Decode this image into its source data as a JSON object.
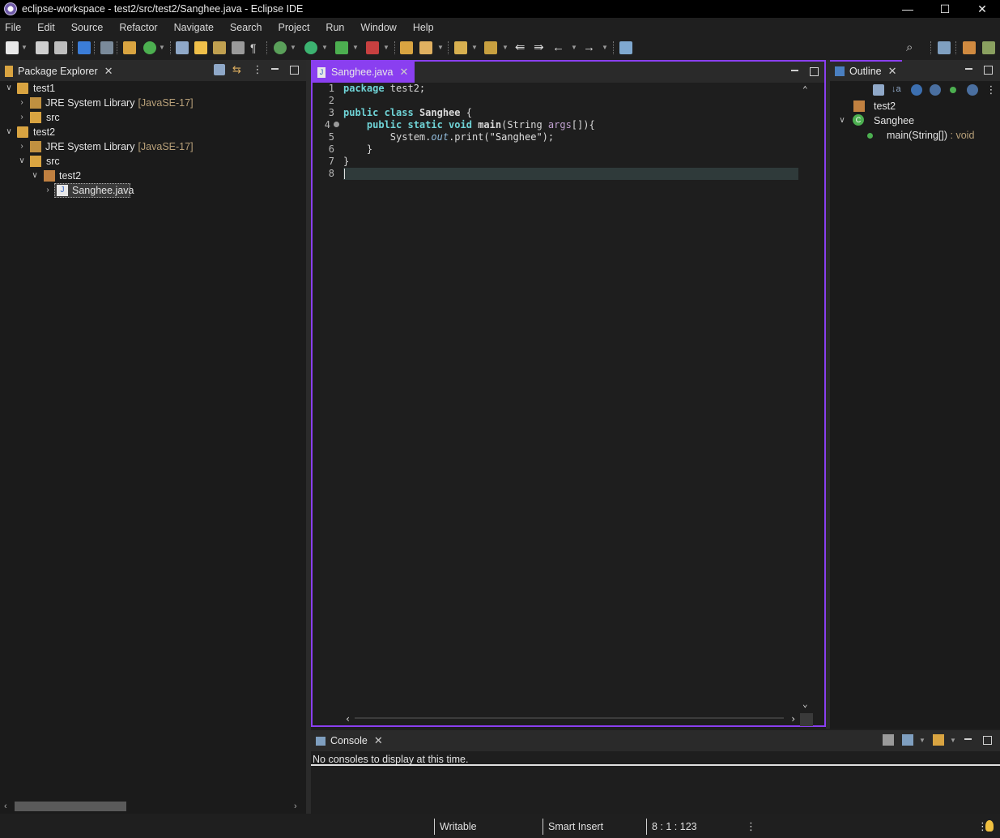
{
  "window": {
    "title": "eclipse-workspace - test2/src/test2/Sanghee.java - Eclipse IDE",
    "controls": {
      "minimize": "—",
      "maximize": "☐",
      "close": "✕"
    }
  },
  "menu": [
    "File",
    "Edit",
    "Source",
    "Refactor",
    "Navigate",
    "Search",
    "Project",
    "Run",
    "Window",
    "Help"
  ],
  "package_explorer": {
    "tab_label": "Package Explorer",
    "tree": [
      {
        "label": "test1",
        "decor": "",
        "expanded": true
      },
      {
        "label": "JRE System Library",
        "decor": "[JavaSE-17]",
        "expanded": false
      },
      {
        "label": "src",
        "decor": "",
        "expanded": false
      },
      {
        "label": "test2",
        "decor": "",
        "expanded": true
      },
      {
        "label": "JRE System Library",
        "decor": "[JavaSE-17]",
        "expanded": false
      },
      {
        "label": "src",
        "decor": "",
        "expanded": true
      },
      {
        "label": "test2",
        "decor": "",
        "expanded": true
      },
      {
        "label": "Sanghee.java",
        "decor": "",
        "expanded": false,
        "selected": true
      }
    ]
  },
  "editor": {
    "tab_label": "Sanghee.java",
    "lines": [
      {
        "num": "1",
        "text": "package test2;"
      },
      {
        "num": "2",
        "text": ""
      },
      {
        "num": "3",
        "text": "public class Sanghee {"
      },
      {
        "num": "4",
        "text": "    public static void main(String args[]){"
      },
      {
        "num": "5",
        "text": "        System.out.print(\"Sanghee\");"
      },
      {
        "num": "6",
        "text": "    }"
      },
      {
        "num": "7",
        "text": "}"
      },
      {
        "num": "8",
        "text": ""
      }
    ]
  },
  "outline": {
    "tab_label": "Outline",
    "items": [
      {
        "label": "test2",
        "type": ""
      },
      {
        "label": "Sanghee",
        "type": ""
      },
      {
        "label": "main(String[])",
        "type": ": void"
      }
    ]
  },
  "console": {
    "tab_label": "Console",
    "message": "No consoles to display at this time."
  },
  "status": {
    "mode": "Writable",
    "insert": "Smart Insert",
    "position": "8 : 1 : 123"
  },
  "colors": {
    "accent": "#8a3ff0",
    "background": "#1b1b1b",
    "keyword": "#6fd3d6"
  }
}
